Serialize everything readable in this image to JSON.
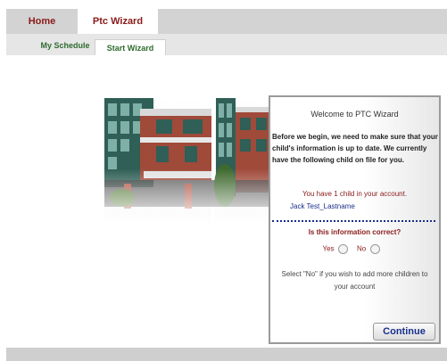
{
  "main_tabs": [
    {
      "label": "Home"
    },
    {
      "label": "Ptc Wizard"
    }
  ],
  "sub_tabs": [
    {
      "label": "My Schedule"
    },
    {
      "label": "Start Wizard"
    }
  ],
  "wizard": {
    "title": "Welcome to PTC Wizard",
    "intro": "Before we begin, we need to make sure that your child's information is up to date. We currently have the following child on file for you.",
    "child_count": "You have 1 child in your account.",
    "child_name": "Jack Test_Lastname",
    "question": "Is this information correct?",
    "yes_label": "Yes",
    "no_label": "No",
    "note": "Select \"No\" if you wish to add more children to your account",
    "continue_label": "Continue"
  },
  "colors": {
    "accent_red": "#8b1a1a",
    "accent_blue": "#1a2f8b",
    "tab_green": "#2e6b2e"
  }
}
